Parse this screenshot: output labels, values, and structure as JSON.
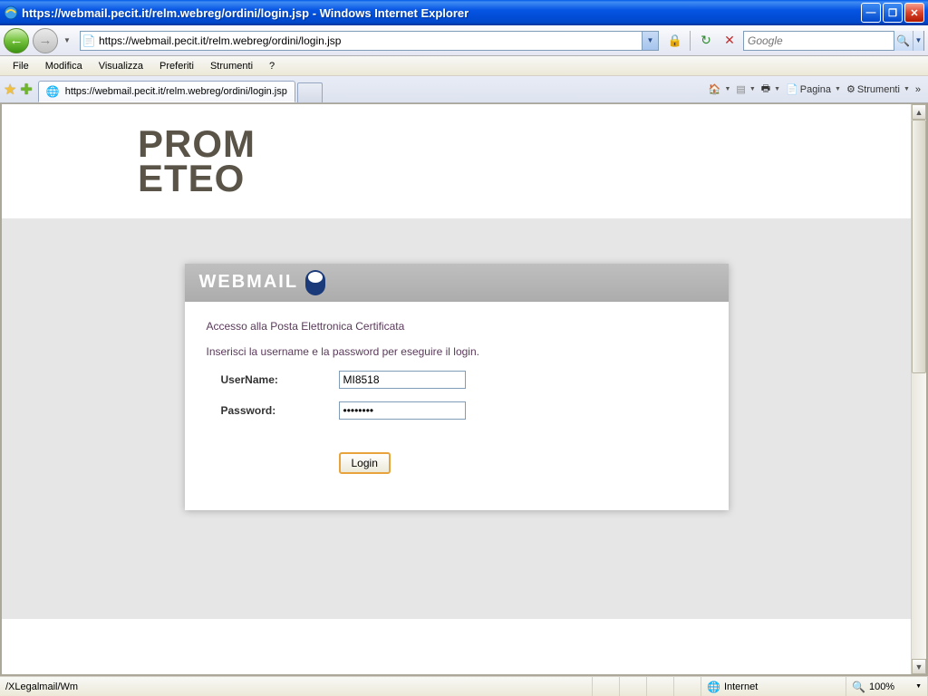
{
  "window": {
    "title": "https://webmail.pecit.it/relm.webreg/ordini/login.jsp - Windows Internet Explorer",
    "url": "https://webmail.pecit.it/relm.webreg/ordini/login.jsp"
  },
  "search": {
    "placeholder": "Google"
  },
  "menu": {
    "file": "File",
    "edit": "Modifica",
    "view": "Visualizza",
    "favorites": "Preferiti",
    "tools": "Strumenti",
    "help": "?"
  },
  "tab": {
    "label": "https://webmail.pecit.it/relm.webreg/ordini/login.jsp"
  },
  "toolbar": {
    "page": "Pagina",
    "tools": "Strumenti"
  },
  "logo": {
    "line1": "PROM",
    "line2": "ETEO"
  },
  "card": {
    "brand": "WEBMAIL",
    "subtitle": "Accesso alla Posta Elettronica Certificata",
    "instruction": "Inserisci la username e la password per eseguire il login.",
    "username_label": "UserName:",
    "username_value": "MI8518",
    "password_label": "Password:",
    "password_value": "••••••••",
    "login_button": "Login"
  },
  "status": {
    "left": "/XLegalmail/Wm",
    "zone": "Internet",
    "zoom": "100%"
  }
}
